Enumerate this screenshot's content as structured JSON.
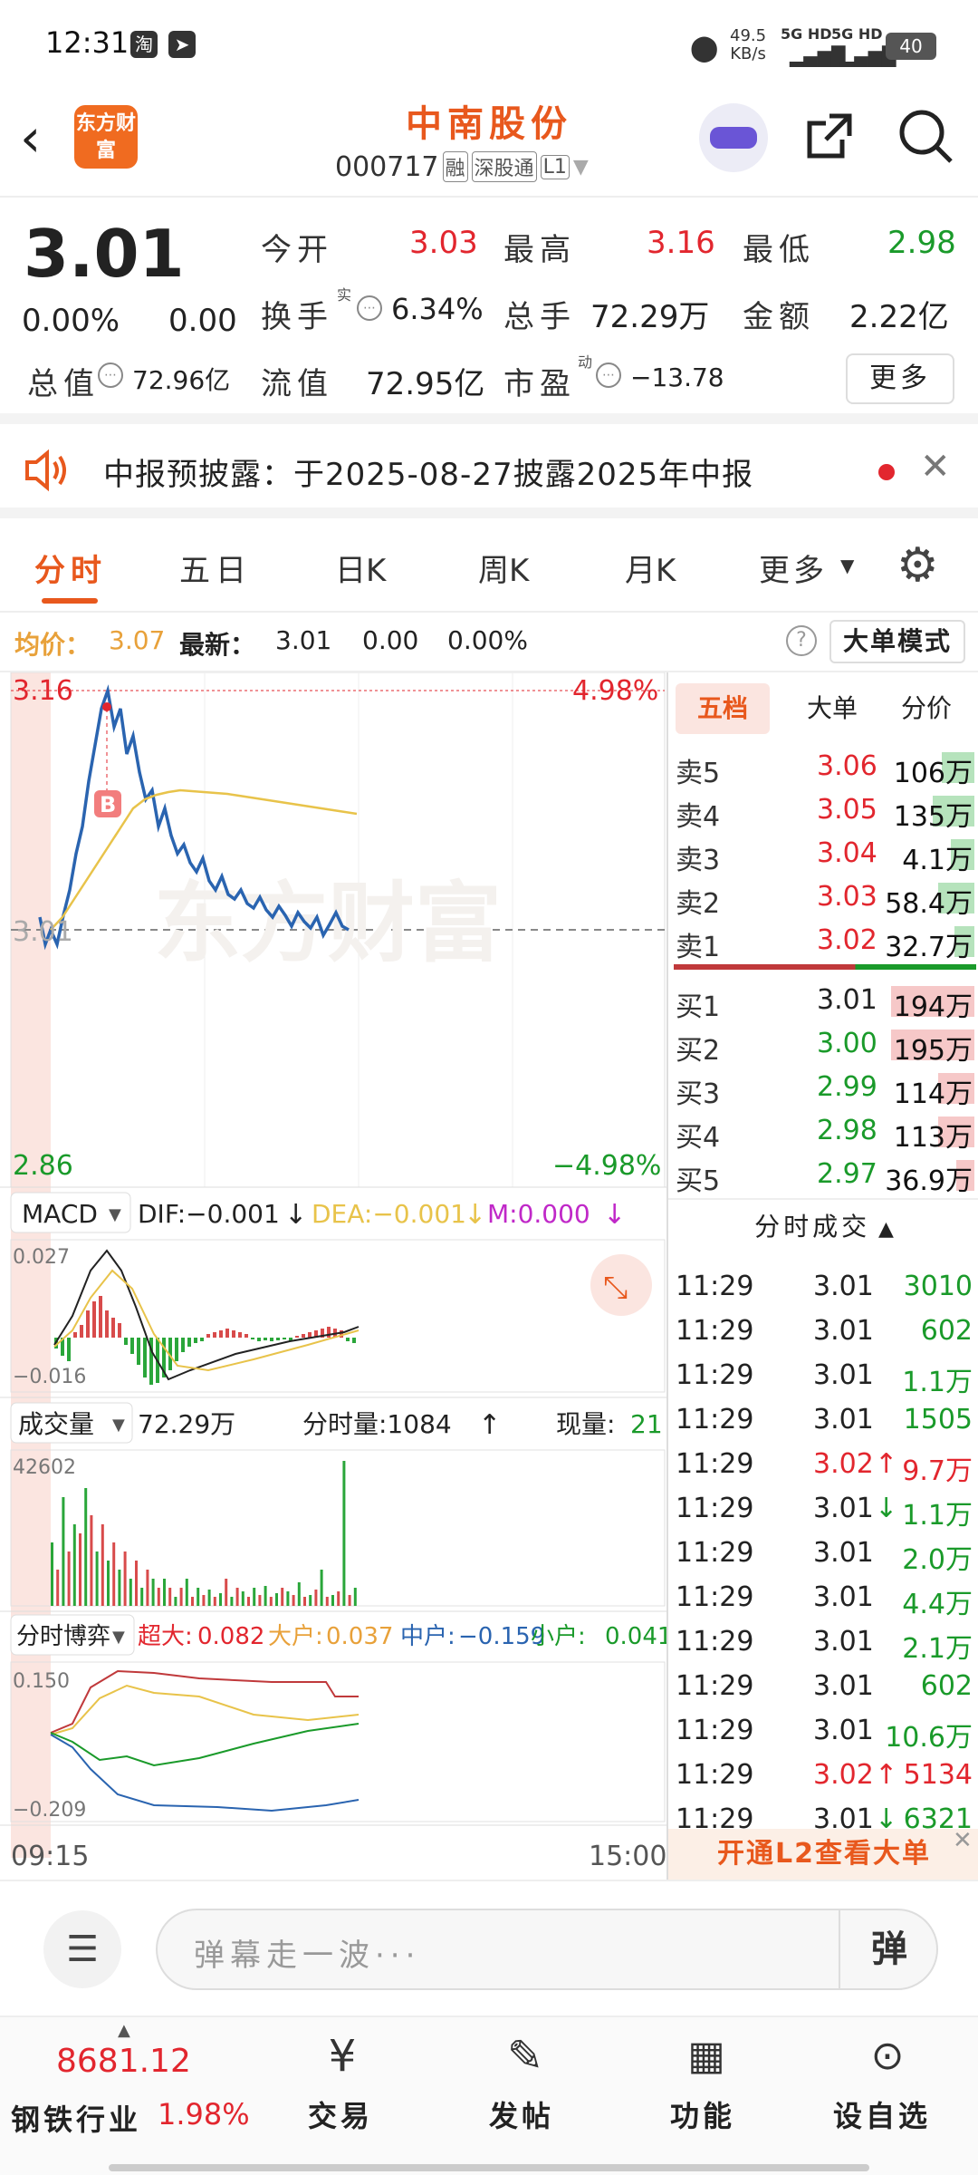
{
  "status": {
    "time": "12:31",
    "speed": "49.5",
    "speed_unit": "KB/s",
    "net1": "5G HD",
    "net2": "5G HD",
    "battery": "40"
  },
  "header": {
    "title": "中南股份",
    "code": "000717",
    "tag1": "融",
    "tag2": "深股通",
    "tag3": "L1",
    "brand": "东方财富"
  },
  "quote": {
    "price": "3.01",
    "change_pct": "0.00%",
    "change": "0.00",
    "open_label": "今开",
    "open": "3.03",
    "high_label": "最高",
    "high": "3.16",
    "low_label": "最低",
    "low": "2.98",
    "turnover_label": "换手",
    "turnover": "6.34%",
    "volume_label": "总手",
    "volume": "72.29万",
    "amount_label": "金额",
    "amount": "2.22亿",
    "mcap_label": "总值",
    "mcap": "72.96亿",
    "float_label": "流值",
    "float": "72.95亿",
    "pe_label": "市盈",
    "pe": "−13.78",
    "more": "更多",
    "real_mark": "实",
    "dyn_mark": "动"
  },
  "notice": {
    "text": "中报预披露：于2025-08-27披露2025年中报"
  },
  "tabs": [
    "分时",
    "五日",
    "日K",
    "周K",
    "月K",
    "更多"
  ],
  "info": {
    "avg_label": "均价：",
    "avg": "3.07",
    "last_label": "最新：",
    "last": "3.01",
    "chg": "0.00",
    "pct": "0.00%",
    "mode": "大单模式"
  },
  "chart": {
    "high_price": "3.16",
    "high_pct": "4.98%",
    "low_price": "2.86",
    "low_pct": "−4.98%",
    "mid_price": "3.01",
    "b_marker": "B",
    "macd_label": "MACD",
    "dif": "DIF:−0.001",
    "dea": "DEA:−0.001",
    "m": "M:0.000",
    "macd_top": "0.027",
    "macd_bottom": "−0.016",
    "vol_label": "成交量",
    "vol_total": "72.29万",
    "vol_tick_label": "分时量:1084",
    "vol_now_label": "现量:",
    "vol_now": "21",
    "vol_top": "42602",
    "flow_label": "分时博弈",
    "super_label": "超大:",
    "super": "0.082",
    "big_label": "大户:",
    "big": "0.037",
    "mid_label": "中户:",
    "mid": "−0.159",
    "small_label": "小户:",
    "small": "0.041",
    "flow_top": "0.150",
    "flow_bottom": "−0.209",
    "time_start": "09:15",
    "time_end": "15:00",
    "watermark": "东方财富",
    "colors": {
      "price_line": "#2a64b0",
      "avg_line": "#e8c34a",
      "up": "#e2262e",
      "down": "#1a9a2a"
    }
  },
  "book": {
    "tabs": [
      "五档",
      "大单",
      "分价"
    ],
    "asks": [
      {
        "label": "卖5",
        "price": "3.06",
        "vol": "106万"
      },
      {
        "label": "卖4",
        "price": "3.05",
        "vol": "135万"
      },
      {
        "label": "卖3",
        "price": "3.04",
        "vol": "4.1万"
      },
      {
        "label": "卖2",
        "price": "3.03",
        "vol": "58.4万"
      },
      {
        "label": "卖1",
        "price": "3.02",
        "vol": "32.7万"
      }
    ],
    "bids": [
      {
        "label": "买1",
        "price": "3.01",
        "vol": "194万"
      },
      {
        "label": "买2",
        "price": "3.00",
        "vol": "195万"
      },
      {
        "label": "买3",
        "price": "2.99",
        "vol": "114万"
      },
      {
        "label": "买4",
        "price": "2.98",
        "vol": "113万"
      },
      {
        "label": "买5",
        "price": "2.97",
        "vol": "36.9万"
      }
    ],
    "ticks_label": "分时成交",
    "ticks": [
      {
        "time": "11:29",
        "price": "3.01",
        "vol": "3010",
        "dir": ""
      },
      {
        "time": "11:29",
        "price": "3.01",
        "vol": "602",
        "dir": ""
      },
      {
        "time": "11:29",
        "price": "3.01",
        "vol": "1.1万",
        "dir": ""
      },
      {
        "time": "11:29",
        "price": "3.01",
        "vol": "1505",
        "dir": ""
      },
      {
        "time": "11:29",
        "price": "3.02",
        "vol": "9.7万",
        "dir": "↑"
      },
      {
        "time": "11:29",
        "price": "3.01",
        "vol": "1.1万",
        "dir": "↓"
      },
      {
        "time": "11:29",
        "price": "3.01",
        "vol": "2.0万",
        "dir": ""
      },
      {
        "time": "11:29",
        "price": "3.01",
        "vol": "4.4万",
        "dir": ""
      },
      {
        "time": "11:29",
        "price": "3.01",
        "vol": "2.1万",
        "dir": ""
      },
      {
        "time": "11:29",
        "price": "3.01",
        "vol": "602",
        "dir": ""
      },
      {
        "time": "11:29",
        "price": "3.01",
        "vol": "10.6万",
        "dir": ""
      },
      {
        "time": "11:29",
        "price": "3.02",
        "vol": "5134",
        "dir": "↑"
      },
      {
        "time": "11:29",
        "price": "3.01",
        "vol": "6321",
        "dir": "↓"
      }
    ],
    "l2_banner": "开通L2查看大单"
  },
  "comment": {
    "placeholder": "弹幕走一波···",
    "danmu": "弹"
  },
  "footer": {
    "index_value": "8681.12",
    "index_name": "钢铁行业",
    "index_pct": "1.98%",
    "items": [
      "交易",
      "发帖",
      "功能",
      "设自选"
    ]
  }
}
